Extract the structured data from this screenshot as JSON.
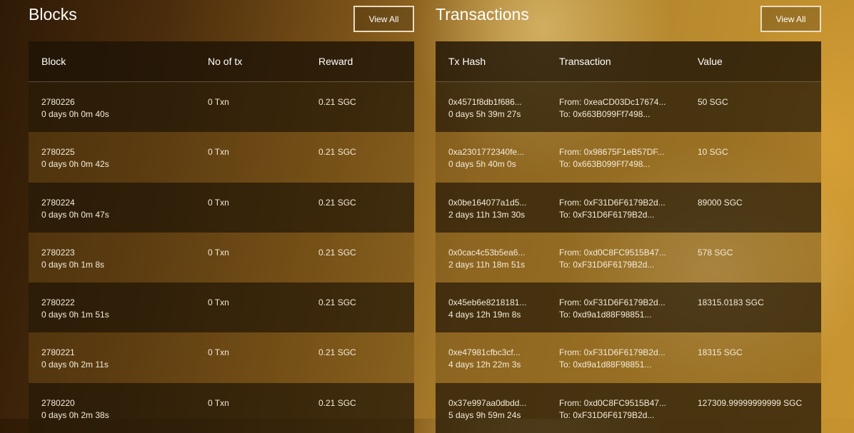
{
  "blocks": {
    "title": "Blocks",
    "view_all": "View All",
    "headers": [
      "Block",
      "No of tx",
      "Reward"
    ],
    "rows": [
      {
        "block": "2780226",
        "age": "0 days 0h 0m 40s",
        "txs": "0 Txn",
        "reward": "0.21 SGC"
      },
      {
        "block": "2780225",
        "age": "0 days 0h 0m 42s",
        "txs": "0 Txn",
        "reward": "0.21 SGC"
      },
      {
        "block": "2780224",
        "age": "0 days 0h 0m 47s",
        "txs": "0 Txn",
        "reward": "0.21 SGC"
      },
      {
        "block": "2780223",
        "age": "0 days 0h 1m 8s",
        "txs": "0 Txn",
        "reward": "0.21 SGC"
      },
      {
        "block": "2780222",
        "age": "0 days 0h 1m 51s",
        "txs": "0 Txn",
        "reward": "0.21 SGC"
      },
      {
        "block": "2780221",
        "age": "0 days 0h 2m 11s",
        "txs": "0 Txn",
        "reward": "0.21 SGC"
      },
      {
        "block": "2780220",
        "age": "0 days 0h 2m 38s",
        "txs": "0 Txn",
        "reward": "0.21 SGC"
      }
    ]
  },
  "transactions": {
    "title": "Transactions",
    "view_all": "View All",
    "headers": [
      "Tx Hash",
      "Transaction",
      "Value"
    ],
    "rows": [
      {
        "hash": "0x4571f8db1f686...",
        "age": "0 days 5h 39m 27s",
        "from": "From: 0xeaCD03Dc17674...",
        "to": "To: 0x663B099Ff7498...",
        "value": "50 SGC"
      },
      {
        "hash": "0xa2301772340fe...",
        "age": "0 days 5h 40m 0s",
        "from": "From: 0x98675F1eB57DF...",
        "to": "To: 0x663B099Ff7498...",
        "value": "10 SGC"
      },
      {
        "hash": "0x0be164077a1d5...",
        "age": "2 days 11h 13m 30s",
        "from": "From: 0xF31D6F6179B2d...",
        "to": "To: 0xF31D6F6179B2d...",
        "value": "89000 SGC"
      },
      {
        "hash": "0x0cac4c53b5ea6...",
        "age": "2 days 11h 18m 51s",
        "from": "From: 0xd0C8FC9515B47...",
        "to": "To: 0xF31D6F6179B2d...",
        "value": "578 SGC"
      },
      {
        "hash": "0x45eb6e8218181...",
        "age": "4 days 12h 19m 8s",
        "from": "From: 0xF31D6F6179B2d...",
        "to": "To: 0xd9a1d88F98851...",
        "value": "18315.0183 SGC"
      },
      {
        "hash": "0xe47981cfbc3cf...",
        "age": "4 days 12h 22m 3s",
        "from": "From: 0xF31D6F6179B2d...",
        "to": "To: 0xd9a1d88F98851...",
        "value": "18315 SGC"
      },
      {
        "hash": "0x37e997aa0dbdd...",
        "age": "5 days 9h 59m 24s",
        "from": "From: 0xd0C8FC9515B47...",
        "to": "To: 0xF31D6F6179B2d...",
        "value": "127309.99999999999 SGC"
      }
    ]
  }
}
